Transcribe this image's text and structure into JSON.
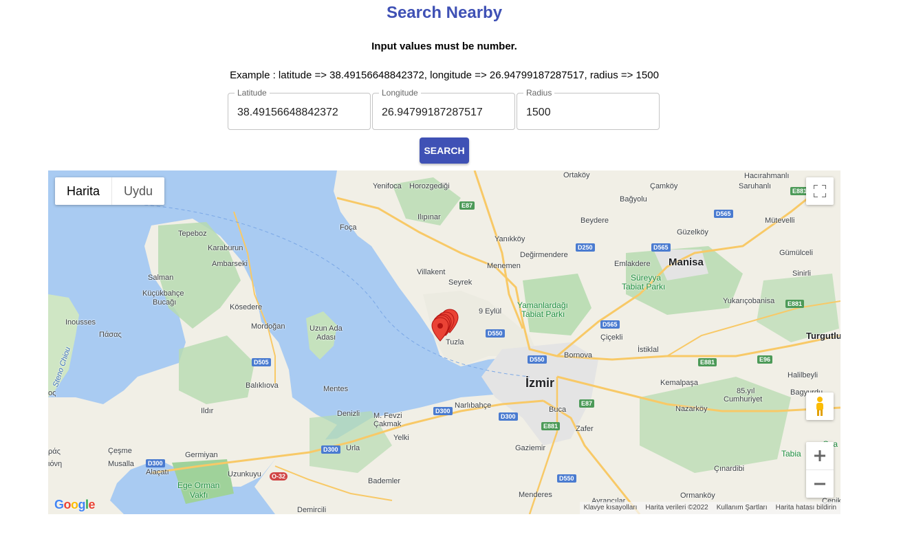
{
  "page": {
    "title": "Search Nearby",
    "notice": "Input values must be number.",
    "example": "Example : latitude => 38.49156648842372, longitude => 26.94799187287517, radius => 1500"
  },
  "form": {
    "latitude": {
      "label": "Latitude",
      "value": "38.49156648842372"
    },
    "longitude": {
      "label": "Longitude",
      "value": "26.94799187287517"
    },
    "radius": {
      "label": "Radius",
      "value": "1500"
    },
    "search_label": "SEARCH"
  },
  "map": {
    "map_type_options": [
      "Harita",
      "Uydu"
    ],
    "selected_map_type": "Harita",
    "places": [
      "Yenifoca",
      "Horozgediği",
      "Ortaköy",
      "Çamköy",
      "Hacırahmanlı",
      "Saruhanlı",
      "Bağyolu",
      "Tepeboz",
      "Foça",
      "Ilıpınar",
      "Beydere",
      "Güzelköy",
      "Mütevelli",
      "Karaburun",
      "Yanıkköy",
      "Ambarseki",
      "Değirmendere",
      "Emlakdere",
      "Gümülceli",
      "Menemen",
      "Salman",
      "Villakent",
      "Sinirli",
      "Küçükbahçe",
      "Bucağı",
      "Seyrek",
      "Yukarıçobanisa",
      "Kösedere",
      "9 Eylül",
      "Inousses",
      "Πάσας",
      "Mordoğan",
      "Uzun Ada",
      "Adası",
      "Çiçekli",
      "İstiklal",
      "Tuzla",
      "Bornova",
      "Halilbeyli",
      "Balıklıova",
      "Mentes",
      "Kemalpaşa",
      "85.yıl",
      "Cumhuriyet",
      "Bagyurdu",
      "Nazarköy",
      "Narlıbahçe",
      "Denizli",
      "M. Fevzi",
      "Çakmak",
      "Buca",
      "Ildır",
      "Yelki",
      "Zafer",
      "Gaziemir",
      "Çeşme",
      "Musalla",
      "Urla",
      "Germiyan",
      "Alaçatı",
      "Uzunkuyu",
      "Çınardibi",
      "Bademler",
      "Menderes",
      "Ormanköy",
      "Ayrancılar",
      "Demircili",
      "Çenik",
      "Turgutlu"
    ],
    "major_places": [
      "Manisa",
      "İzmir"
    ],
    "parks": [
      "Süreyya",
      "Tabiat Parkı",
      "Yamanlardağı",
      "Tabiat Parkı",
      "Ege Orman",
      "Vakfı",
      "Ova",
      "Tabia"
    ],
    "sea_labels": [
      "Steno Chiou",
      "ος",
      "ράς",
      "ιόνη"
    ],
    "road_shields": [
      "E87",
      "D565",
      "D250",
      "D565",
      "E881",
      "D550",
      "D565",
      "D550",
      "E881",
      "E96",
      "E881",
      "D505",
      "E87",
      "D300",
      "D300",
      "E881",
      "D300",
      "D550",
      "O-32",
      "D300"
    ],
    "marker_count": 5,
    "attribution": [
      "Klavye kısayolları",
      "Harita verileri ©2022",
      "Kullanım Şartları",
      "Harita hatası bildirin"
    ],
    "logo": "Google"
  },
  "colors": {
    "accent": "#3f51b5",
    "sea": "#a9cbf2",
    "land": "#f1efe6",
    "park": "#b7dbb0",
    "road_major": "#f8c967",
    "marker": "#ea4335"
  }
}
